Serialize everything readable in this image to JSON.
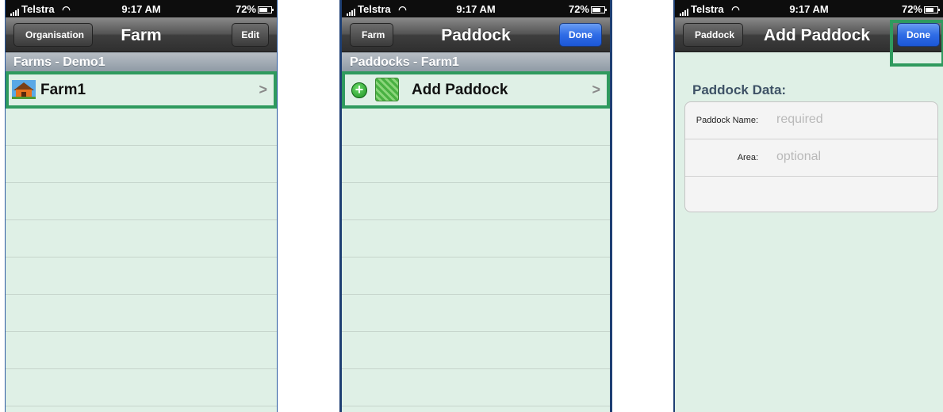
{
  "status": {
    "carrier": "Telstra",
    "time": "9:17 AM",
    "battery": "72%"
  },
  "screen1": {
    "back_label": "Organisation",
    "title": "Farm",
    "right_label": "Edit",
    "section": "Farms - Demo1",
    "item_label": "Farm1",
    "chevron": ">"
  },
  "screen2": {
    "back_label": "Farm",
    "title": "Paddock",
    "right_label": "Done",
    "section": "Paddocks - Farm1",
    "item_label": "Add Paddock",
    "chevron": ">",
    "add_glyph": "+"
  },
  "screen3": {
    "back_label": "Paddock",
    "title": "Add Paddock",
    "right_label": "Done",
    "form_heading": "Paddock Data:",
    "fields": [
      {
        "label": "Paddock Name:",
        "placeholder": "required"
      },
      {
        "label": "Area:",
        "placeholder": "optional"
      }
    ]
  },
  "colors": {
    "highlight": "#2f9a5e",
    "done_blue": "#2f6ce6",
    "table_bg": "#dff0e6"
  }
}
